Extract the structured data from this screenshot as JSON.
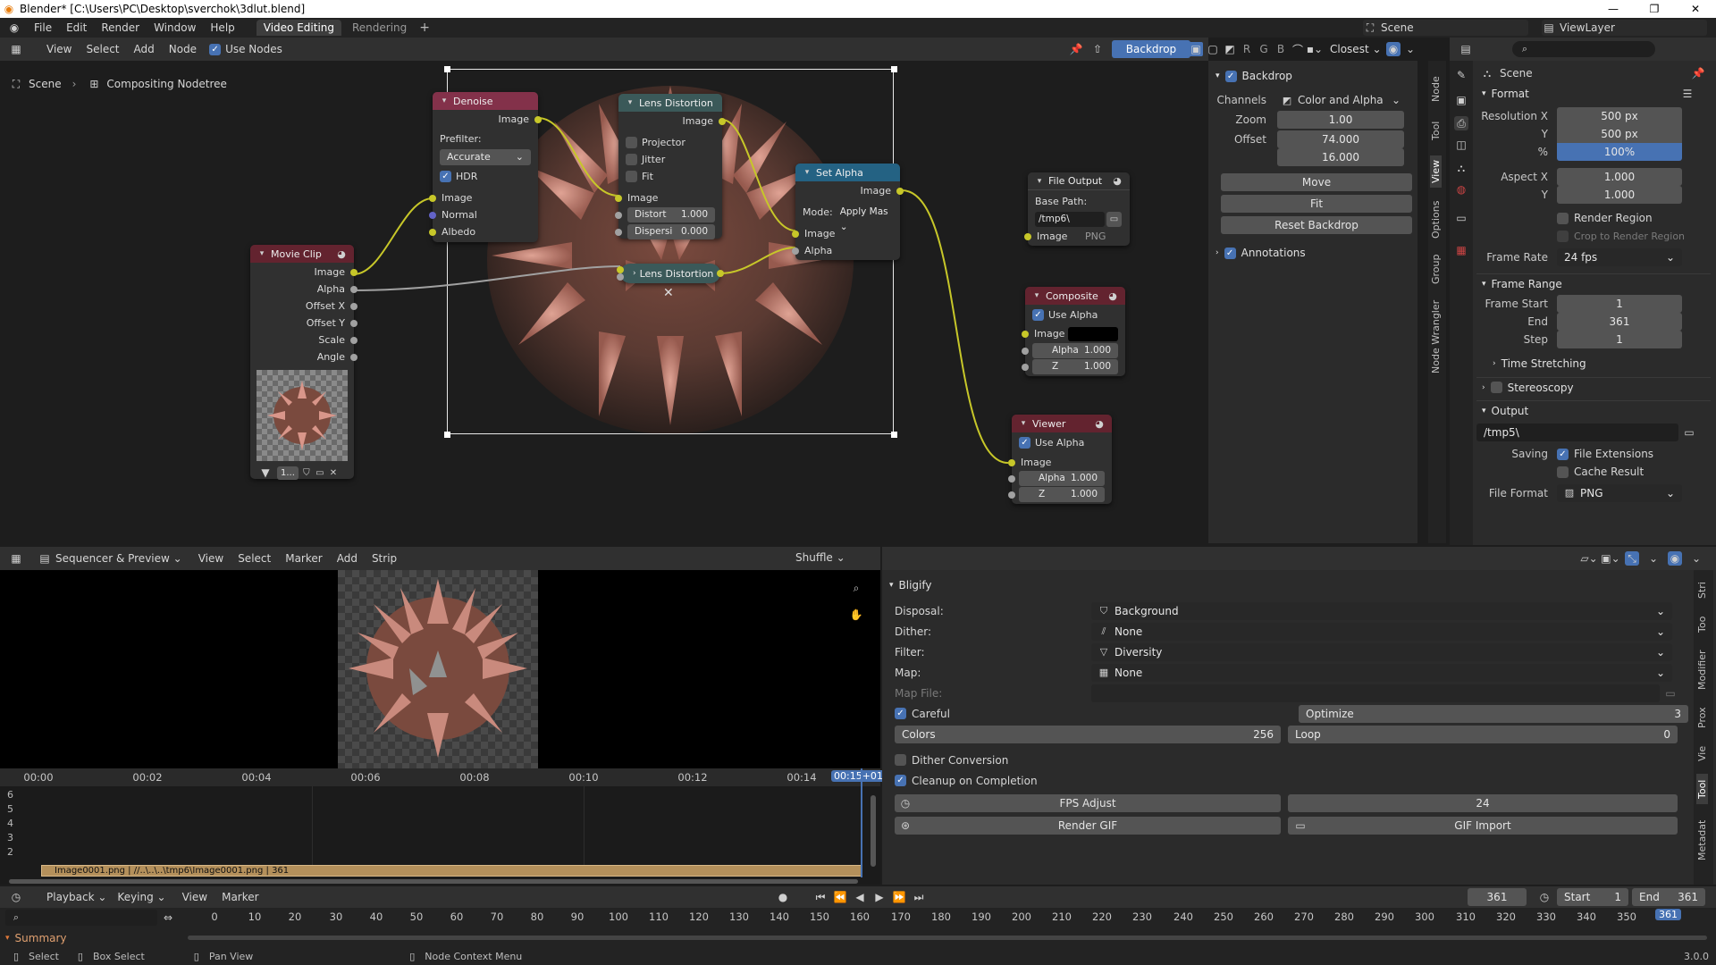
{
  "window": {
    "title": "Blender* [C:\\Users\\PC\\Desktop\\sverchok\\3dlut.blend]",
    "menu": [
      "File",
      "Edit",
      "Render",
      "Window",
      "Help"
    ],
    "workspaces": [
      "Video Editing",
      "Rendering"
    ],
    "add_workspace": "+",
    "scene": "Scene",
    "view_layer": "ViewLayer"
  },
  "node_editor": {
    "menus": [
      "View",
      "Select",
      "Add",
      "Node"
    ],
    "use_nodes_label": "Use Nodes",
    "breadcrumb": [
      "Scene",
      "Compositing Nodetree"
    ],
    "backdrop_button": "Backdrop",
    "channel_buttons": [
      "R",
      "G",
      "B"
    ],
    "interpolation": "Closest",
    "nodes": {
      "denoise": {
        "title": "Denoise",
        "out_image": "Image",
        "prefilter_label": "Prefilter:",
        "prefilter_value": "Accurate",
        "hdr": "HDR",
        "in_image": "Image",
        "in_normal": "Normal",
        "in_albedo": "Albedo"
      },
      "lens1": {
        "title": "Lens Distortion",
        "out_image": "Image",
        "projector": "Projector",
        "jitter": "Jitter",
        "fit": "Fit",
        "in_image": "Image",
        "distort_label": "Distort",
        "distort_value": "1.000",
        "dispersion_label": "Dispersi",
        "dispersion_value": "0.000"
      },
      "set_alpha": {
        "title": "Set Alpha",
        "out_image": "Image",
        "mode_label": "Mode:",
        "mode_value": "Apply Mas",
        "in_image": "Image",
        "in_alpha": "Alpha"
      },
      "movie_clip": {
        "title": "Movie Clip",
        "outputs": [
          "Image",
          "Alpha",
          "Offset X",
          "Offset Y",
          "Scale",
          "Angle"
        ],
        "clip_field": "1..."
      },
      "lens2": {
        "title": "Lens Distortion"
      },
      "file_output": {
        "title": "File Output",
        "base_path_label": "Base Path:",
        "base_path": "/tmp6\\",
        "in_image": "Image",
        "format": "PNG"
      },
      "composite": {
        "title": "Composite",
        "use_alpha": "Use Alpha",
        "in_image": "Image",
        "alpha_label": "Alpha",
        "alpha_value": "1.000",
        "z_label": "Z",
        "z_value": "1.000"
      },
      "viewer": {
        "title": "Viewer",
        "use_alpha": "Use Alpha",
        "in_image": "Image",
        "alpha_label": "Alpha",
        "alpha_value": "1.000",
        "z_label": "Z",
        "z_value": "1.000"
      }
    }
  },
  "sidebar": {
    "backdrop_title": "Backdrop",
    "channels_label": "Channels",
    "channels_value": "Color and Alpha",
    "zoom_label": "Zoom",
    "zoom_value": "1.00",
    "offset_label": "Offset",
    "offset_x": "74.000",
    "offset_y": "16.000",
    "move": "Move",
    "fit": "Fit",
    "reset_backdrop": "Reset Backdrop",
    "annotations": "Annotations",
    "tabs": [
      "Node",
      "Tool",
      "View",
      "Options",
      "Group",
      "Node Wrangler"
    ]
  },
  "properties": {
    "scene": "Scene",
    "format_title": "Format",
    "res_x_label": "Resolution X",
    "res_x": "500 px",
    "res_y_label": "Y",
    "res_y": "500 px",
    "res_pct_label": "%",
    "res_pct": "100%",
    "aspect_x_label": "Aspect X",
    "aspect_x": "1.000",
    "aspect_y_label": "Y",
    "aspect_y": "1.000",
    "render_region": "Render Region",
    "crop_region": "Crop to Render Region",
    "frame_rate_label": "Frame Rate",
    "frame_rate": "24 fps",
    "frame_range_title": "Frame Range",
    "frame_start_label": "Frame Start",
    "frame_start": "1",
    "end_label": "End",
    "end": "361",
    "step_label": "Step",
    "step": "1",
    "time_stretching": "Time Stretching",
    "stereoscopy": "Stereoscopy",
    "output_title": "Output",
    "output_path": "/tmp5\\",
    "saving_label": "Saving",
    "file_extensions": "File Extensions",
    "cache_result": "Cache Result",
    "file_format_label": "File Format",
    "file_format": "PNG"
  },
  "sequencer": {
    "mode": "Sequencer & Preview",
    "menus": [
      "View",
      "Select",
      "Marker",
      "Add",
      "Strip"
    ],
    "overlap": "Shuffle",
    "times": [
      "00:00",
      "00:02",
      "00:04",
      "00:06",
      "00:08",
      "00:10",
      "00:12",
      "00:14"
    ],
    "current_time": "00:15+01",
    "channels": [
      "6",
      "5",
      "4",
      "3",
      "2"
    ],
    "strip_label": "Image0001.png | //..\\..\\..\\tmp6\\Image0001.png | 361"
  },
  "bligify": {
    "title": "Bligify",
    "disposal_label": "Disposal:",
    "disposal": "Background",
    "dither_label": "Dither:",
    "dither": "None",
    "filter_label": "Filter:",
    "filter": "Diversity",
    "map_label": "Map:",
    "map": "None",
    "map_file_label": "Map File:",
    "careful": "Careful",
    "optimize_label": "Optimize",
    "optimize": "3",
    "colors_label": "Colors",
    "colors": "256",
    "loop_label": "Loop",
    "loop": "0",
    "dither_conversion": "Dither Conversion",
    "cleanup": "Cleanup on Completion",
    "fps_adjust": "FPS Adjust",
    "fps_value": "24",
    "render_gif": "Render GIF",
    "gif_import": "GIF Import",
    "tabs": [
      "Stri",
      "Too",
      "Modifier",
      "Prox",
      "Vie",
      "Tool",
      "Metadat"
    ]
  },
  "timeline": {
    "playback": "Playback",
    "keying": "Keying",
    "view": "View",
    "marker": "Marker",
    "current_frame": "361",
    "start_label": "Start",
    "start": "1",
    "end_label": "End",
    "end": "361",
    "ticks": [
      "0",
      "10",
      "20",
      "30",
      "40",
      "50",
      "60",
      "70",
      "80",
      "90",
      "100",
      "110",
      "120",
      "130",
      "140",
      "150",
      "160",
      "170",
      "180",
      "190",
      "200",
      "210",
      "220",
      "230",
      "240",
      "250",
      "260",
      "270",
      "280",
      "290",
      "300",
      "310",
      "320",
      "330",
      "340",
      "350"
    ],
    "playhead": "361",
    "summary": "Summary"
  },
  "statusbar": {
    "select": "Select",
    "box_select": "Box Select",
    "pan_view": "Pan View",
    "context_menu": "Node Context Menu",
    "version": "3.0.0"
  },
  "colors": {
    "accent": "#4772b3",
    "socket_yellow": "#c7c729",
    "socket_gray": "#a1a1a1",
    "socket_purple": "#6363c7",
    "link_yellow": "#c7c729",
    "node_header_purple": "#83314a",
    "node_header_teal": "#3b5959",
    "node_header_blue": "#246283",
    "node_header_red": "#63232f",
    "strip_color": "#b4905b"
  }
}
